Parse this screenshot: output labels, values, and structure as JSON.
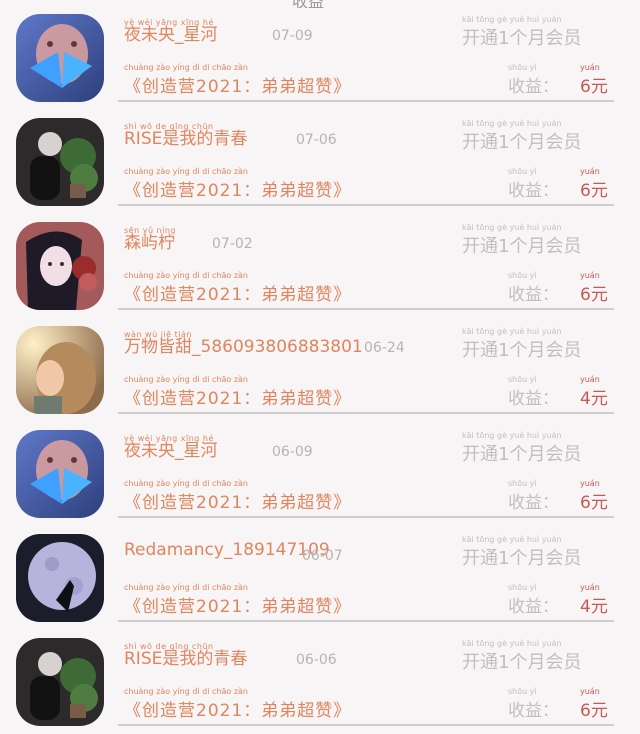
{
  "header": {
    "cut_title": "收益"
  },
  "colors": {
    "name": "#e0855e",
    "muted": "#c4bdbd",
    "amount": "#c75a55"
  },
  "rows": [
    {
      "avatar": "avatar-blue-butterfly",
      "name": "夜未央_星河",
      "name_pinyin": "yè wèi yāng xīng hé",
      "date": "07-09",
      "membership": "开通1个月会员",
      "membership_pinyin": "kāi tōng gè yuè huì yuán",
      "campaign": "《创造营2021：弟弟超赞》",
      "campaign_pinyin": "chuàng zào yíng dì di chāo zàn",
      "income_label": "收益：",
      "income_pinyin": "shōu yì",
      "income_value": "6元",
      "income_value_pinyin": "yuán"
    },
    {
      "avatar": "avatar-dark-plant",
      "name": "RISE是我的青春",
      "name_pinyin": "shì wǒ de qīng chūn",
      "date": "07-06",
      "membership": "开通1个月会员",
      "membership_pinyin": "kāi tōng gè yuè huì yuán",
      "campaign": "《创造营2021：弟弟超赞》",
      "campaign_pinyin": "chuàng zào yíng dì di chāo zàn",
      "income_label": "收益：",
      "income_pinyin": "shōu yì",
      "income_value": "6元",
      "income_value_pinyin": "yuán"
    },
    {
      "avatar": "avatar-girl-flowers",
      "name": "森屿柠",
      "name_pinyin": "sēn yǔ níng",
      "date": "07-02",
      "membership": "开通1个月会员",
      "membership_pinyin": "kāi tōng gè yuè huì yuán",
      "campaign": "《创造营2021：弟弟超赞》",
      "campaign_pinyin": "chuàng zào yíng dì di chāo zàn",
      "income_label": "收益：",
      "income_pinyin": "shōu yì",
      "income_value": "6元",
      "income_value_pinyin": "yuán"
    },
    {
      "avatar": "avatar-girl-sunlight",
      "name": "万物皆甜_586093806883801",
      "name_pinyin": "wàn wù jiē tián",
      "date": "06-24",
      "membership": "开通1个月会员",
      "membership_pinyin": "kāi tōng gè yuè huì yuán",
      "campaign": "《创造营2021：弟弟超赞》",
      "campaign_pinyin": "chuàng zào yíng dì di chāo zàn",
      "income_label": "收益：",
      "income_pinyin": "shōu yì",
      "income_value": "4元",
      "income_value_pinyin": "yuán"
    },
    {
      "avatar": "avatar-blue-butterfly",
      "name": "夜未央_星河",
      "name_pinyin": "yè wèi yāng xīng hé",
      "date": "06-09",
      "membership": "开通1个月会员",
      "membership_pinyin": "kāi tōng gè yuè huì yuán",
      "campaign": "《创造营2021：弟弟超赞》",
      "campaign_pinyin": "chuàng zào yíng dì di chāo zàn",
      "income_label": "收益：",
      "income_pinyin": "shōu yì",
      "income_value": "6元",
      "income_value_pinyin": "yuán"
    },
    {
      "avatar": "avatar-moon",
      "name": "Redamancy_189147109",
      "name_pinyin": "",
      "date": "06-07",
      "membership": "开通1个月会员",
      "membership_pinyin": "kāi tōng gè yuè huì yuán",
      "campaign": "《创造营2021：弟弟超赞》",
      "campaign_pinyin": "chuàng zào yíng dì di chāo zàn",
      "income_label": "收益：",
      "income_pinyin": "shōu yì",
      "income_value": "4元",
      "income_value_pinyin": "yuán"
    },
    {
      "avatar": "avatar-dark-plant",
      "name": "RISE是我的青春",
      "name_pinyin": "shì wǒ de qīng chūn",
      "date": "06-06",
      "membership": "开通1个月会员",
      "membership_pinyin": "kāi tōng gè yuè huì yuán",
      "campaign": "《创造营2021：弟弟超赞》",
      "campaign_pinyin": "chuàng zào yíng dì di chāo zàn",
      "income_label": "收益：",
      "income_pinyin": "shōu yì",
      "income_value": "6元",
      "income_value_pinyin": "yuán"
    }
  ]
}
